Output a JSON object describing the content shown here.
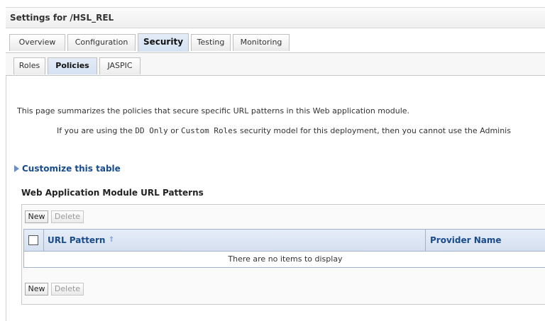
{
  "header": {
    "title": "Settings for /HSL_REL"
  },
  "tabs": [
    {
      "label": "Overview"
    },
    {
      "label": "Configuration"
    },
    {
      "label": "Security"
    },
    {
      "label": "Testing"
    },
    {
      "label": "Monitoring"
    }
  ],
  "subtabs": [
    {
      "label": "Roles"
    },
    {
      "label": "Policies"
    },
    {
      "label": "JASPIC"
    }
  ],
  "content": {
    "intro": "This page summarizes the policies that secure specific URL patterns in this Web application module.",
    "warning": {
      "part1": "If you are using the ",
      "dd_only": "DD Only",
      "part2": " or ",
      "custom_roles": "Custom Roles",
      "part3": " security model for this deployment, then you cannot use the Adminis"
    },
    "customize_link": "Customize this table"
  },
  "table": {
    "title": "Web Application Module URL Patterns",
    "buttons": {
      "new": "New",
      "delete": "Delete"
    },
    "columns": [
      {
        "label": "URL Pattern",
        "sort_icon": "sort-ascending-icon"
      },
      {
        "label": "Provider Name"
      }
    ],
    "empty_message": "There are no items to display"
  }
}
